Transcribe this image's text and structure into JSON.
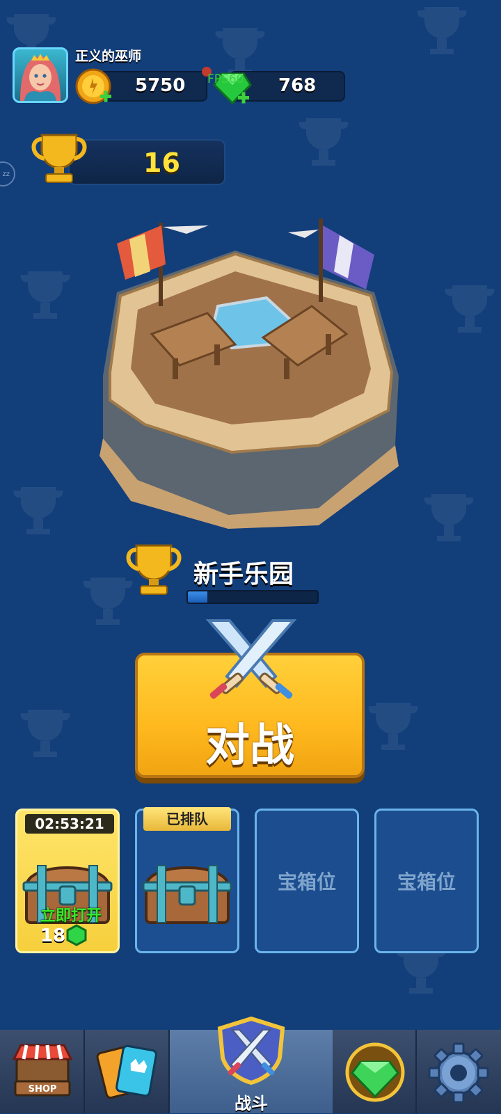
{
  "player": {
    "name": "正义的巫师",
    "coins": "5750",
    "gems": "768",
    "trophies": "16"
  },
  "debug": {
    "fps_label": "FPS60",
    "side_bubble": "zz"
  },
  "arena": {
    "name": "新手乐园",
    "progress": 0.15
  },
  "battle": {
    "label": "对战"
  },
  "chest_slots": [
    {
      "state": "ready",
      "timer": "02:53:21",
      "action_label": "立即打开",
      "cost": "18"
    },
    {
      "state": "queued",
      "tag": "已排队"
    },
    {
      "state": "empty",
      "label": "宝箱位"
    },
    {
      "state": "empty",
      "label": "宝箱位"
    }
  ],
  "nav": {
    "shop_label": "SHOP",
    "active_label": "战斗",
    "items": [
      "shop",
      "cards",
      "battle",
      "gems",
      "settings"
    ]
  },
  "colors": {
    "background": "#123e7a",
    "button_gold": "#ffc228",
    "trophy_yellow": "#ffe23a",
    "gem_green": "#2fd447",
    "slot_border": "#6ab4ea"
  }
}
